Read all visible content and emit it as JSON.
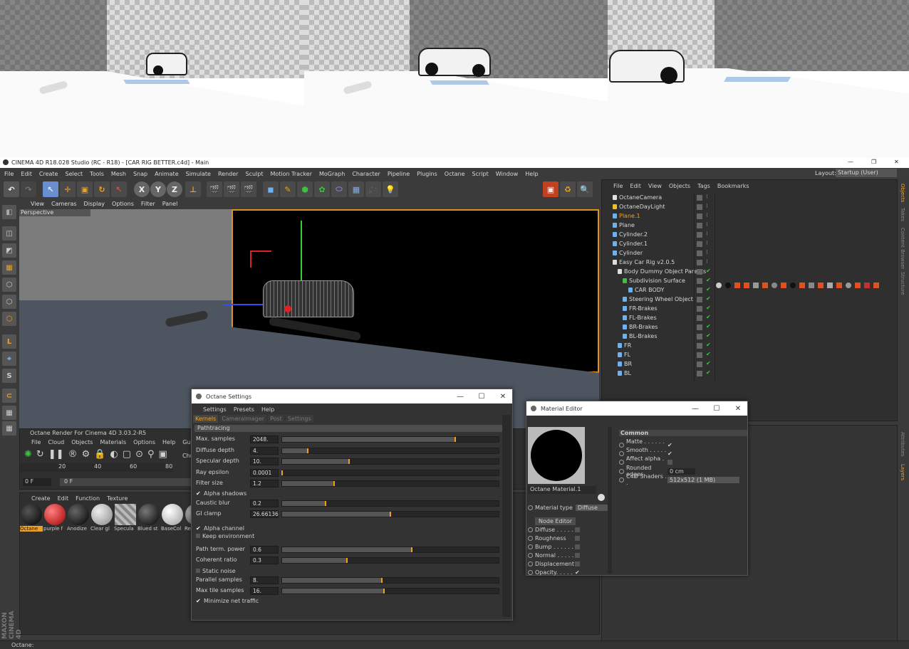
{
  "renders": {
    "count": 3
  },
  "window": {
    "title": "CINEMA 4D R18.028 Studio (RC - R18) - [CAR RIG BETTER.c4d] - Main",
    "controls": [
      "—",
      "❐",
      "✕"
    ]
  },
  "menubar": {
    "items": [
      "File",
      "Edit",
      "Create",
      "Select",
      "Tools",
      "Mesh",
      "Snap",
      "Animate",
      "Simulate",
      "Render",
      "Sculpt",
      "Motion Tracker",
      "MoGraph",
      "Character",
      "Pipeline",
      "Plugins",
      "Octane",
      "Script",
      "Window",
      "Help"
    ],
    "layout_label": "Layout:",
    "layout_value": "Startup (User)"
  },
  "toolbar": {
    "axis_x": "X",
    "axis_y": "Y",
    "axis_z": "Z"
  },
  "viewport": {
    "menu": [
      "View",
      "Cameras",
      "Display",
      "Options",
      "Filter",
      "Panel"
    ],
    "label": "Perspective"
  },
  "object_manager": {
    "menu": [
      "File",
      "Edit",
      "View",
      "Objects",
      "Tags",
      "Bookmarks"
    ],
    "objects": [
      {
        "name": "OctaneCamera",
        "indent": 0
      },
      {
        "name": "OctaneDayLight",
        "indent": 0
      },
      {
        "name": "Plane.1",
        "indent": 0,
        "selected": true
      },
      {
        "name": "Plane",
        "indent": 0
      },
      {
        "name": "Cylinder.2",
        "indent": 0
      },
      {
        "name": "Cylinder.1",
        "indent": 0
      },
      {
        "name": "Cylinder",
        "indent": 0
      },
      {
        "name": "Easy Car Rig v2.0.5",
        "indent": 0
      },
      {
        "name": "Body Dummy Object Parents",
        "indent": 1
      },
      {
        "name": "Subdivision Surface",
        "indent": 2
      },
      {
        "name": "CAR BODY",
        "indent": 3
      },
      {
        "name": "Steering Wheel Object",
        "indent": 2
      },
      {
        "name": "FR-Brakes",
        "indent": 2
      },
      {
        "name": "FL-Brakes",
        "indent": 2
      },
      {
        "name": "BR-Brakes",
        "indent": 2
      },
      {
        "name": "BL-Brakes",
        "indent": 2
      },
      {
        "name": "FR",
        "indent": 1
      },
      {
        "name": "FL",
        "indent": 1
      },
      {
        "name": "BR",
        "indent": 1
      },
      {
        "name": "BL",
        "indent": 1
      }
    ],
    "side_tabs": [
      "Objects",
      "Takes",
      "Content Browser",
      "Structure"
    ]
  },
  "attributes_tabs": [
    "Attributes",
    "Layers"
  ],
  "timeline": {
    "title": "Octane Render For Cinema 4D 3.03.2-R5",
    "menu": [
      "File",
      "Cloud",
      "Objects",
      "Materials",
      "Options",
      "Help",
      "Gui"
    ],
    "ticks": [
      "20",
      "40",
      "60",
      "80"
    ],
    "frame_value": "0 F",
    "frame_value2": "0 F",
    "chn_label": "Chn"
  },
  "material_manager": {
    "menu": [
      "Create",
      "Edit",
      "Function",
      "Texture"
    ],
    "materials": [
      {
        "name": "Octane",
        "color": "#0a0a0a",
        "selected": true
      },
      {
        "name": "purple f",
        "color": "#cc2020"
      },
      {
        "name": "Anodize",
        "color": "#181818"
      },
      {
        "name": "Clear gl",
        "color": "#bdbdbd"
      },
      {
        "name": "Specula",
        "color": "#999999"
      },
      {
        "name": "Blued st",
        "color": "#222222"
      },
      {
        "name": "BaseCol",
        "color": "#cfcfcf"
      },
      {
        "name": "Ref",
        "color": "#7a7a7a"
      }
    ]
  },
  "octane_settings": {
    "title": "Octane Settings",
    "menu": [
      "Settings",
      "Presets",
      "Help"
    ],
    "tabs": [
      "Kernels",
      "CameraImager",
      "Post",
      "Settings"
    ],
    "kernel": "Pathtracing",
    "params": [
      {
        "label": "Max. samples",
        "value": "2048.",
        "fill": 0.8
      },
      {
        "label": "Diffuse depth",
        "value": "4.",
        "fill": 0.12
      },
      {
        "label": "Specular depth",
        "value": "10.",
        "fill": 0.31
      },
      {
        "label": "Ray epsilon",
        "value": "0.0001",
        "fill": 0.0
      },
      {
        "label": "Filter size",
        "value": "1.2",
        "fill": 0.24
      }
    ],
    "alpha_shadows": "Alpha shadows",
    "params2": [
      {
        "label": "Caustic blur",
        "value": "0.2",
        "fill": 0.2
      },
      {
        "label": "GI clamp",
        "value": "26.66136",
        "fill": 0.5
      }
    ],
    "alpha_channel": "Alpha channel",
    "keep_environment": "Keep environment",
    "params3": [
      {
        "label": "Path term. power",
        "value": "0.6",
        "fill": 0.6
      },
      {
        "label": "Coherent ratio",
        "value": "0.3",
        "fill": 0.3
      }
    ],
    "static_noise": "Static noise",
    "params4": [
      {
        "label": "Parallel samples",
        "value": "8.",
        "fill": 0.46
      },
      {
        "label": "Max tile samples",
        "value": "16.",
        "fill": 0.47
      }
    ],
    "minimize_net": "Minimize net traffic"
  },
  "material_editor": {
    "title": "Material Editor",
    "material_name": "Octane Material.1",
    "material_type_label": "Material type",
    "material_type_value": "Diffuse",
    "node_editor": "Node Editor",
    "channels": [
      "Diffuse . . . . .",
      "Roughness",
      "Bump . . . . . .",
      "Normal . . . . .",
      "Displacement",
      "Opacity. . . . ."
    ],
    "section": "Common",
    "common": [
      {
        "label": "Matte . . . . . . . .",
        "checked": true
      },
      {
        "label": "Smooth . . . . . . .",
        "checked": true
      },
      {
        "label": "Affect alpha . . .",
        "checked": false
      }
    ],
    "rounded_label": "Rounded edges",
    "rounded_value": "0 cm",
    "shaders_label": "C4D Shaders . .",
    "shaders_value": "512x512 (1 MB)"
  },
  "statusbar": {
    "text": "Octane:"
  },
  "branding": {
    "line1": "MAXON",
    "line2": "CINEMA 4D"
  }
}
